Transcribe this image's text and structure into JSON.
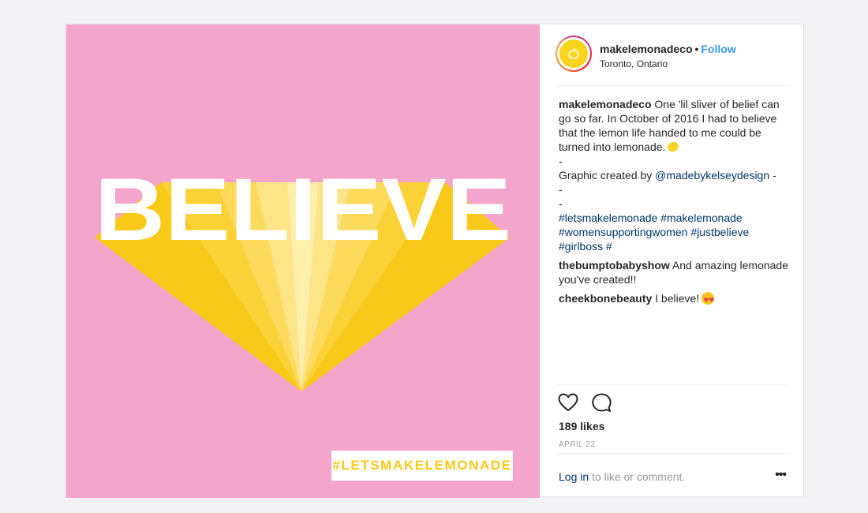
{
  "post": {
    "image": {
      "headline": "BELIEVE",
      "hashtag_badge": "#LETSMAKELEMONADE",
      "colors": {
        "background": "#f4a5cb",
        "yellow": "#f9c91a",
        "white": "#ffffff"
      }
    },
    "header": {
      "username": "makelemonadeco",
      "separator": "•",
      "follow_label": "Follow",
      "location": "Toronto, Ontario",
      "avatar_icon": "lemon-icon"
    },
    "caption": {
      "username": "makelemonadeco",
      "text": "One 'lil sliver of belief can go so far. In October of 2016 I had to believe that the lemon life handed to me could be turned into lemonade.",
      "dash1": "-",
      "credit_prefix": "Graphic created by ",
      "credit_mention": "@madebykelseydesign",
      "credit_suffix": " -",
      "dash2": "-",
      "dash3": "-",
      "hashtags": [
        "#letsmakelemonade",
        "#makelemonade",
        "#womensupportingwomen",
        "#justbelieve",
        "#girlboss",
        "#"
      ]
    },
    "comments": [
      {
        "username": "thebumptobabyshow",
        "text": "And amazing lemonade you've created!!"
      },
      {
        "username": "cheekbonebeauty",
        "text": "I believe!"
      }
    ],
    "likes": "189 likes",
    "date": "APRIL 22",
    "footer": {
      "login_label": "Log in",
      "login_suffix": " to like or comment.",
      "more_label": "•••"
    },
    "accent_colors": {
      "link": "#003569",
      "follow": "#3897f0"
    }
  }
}
